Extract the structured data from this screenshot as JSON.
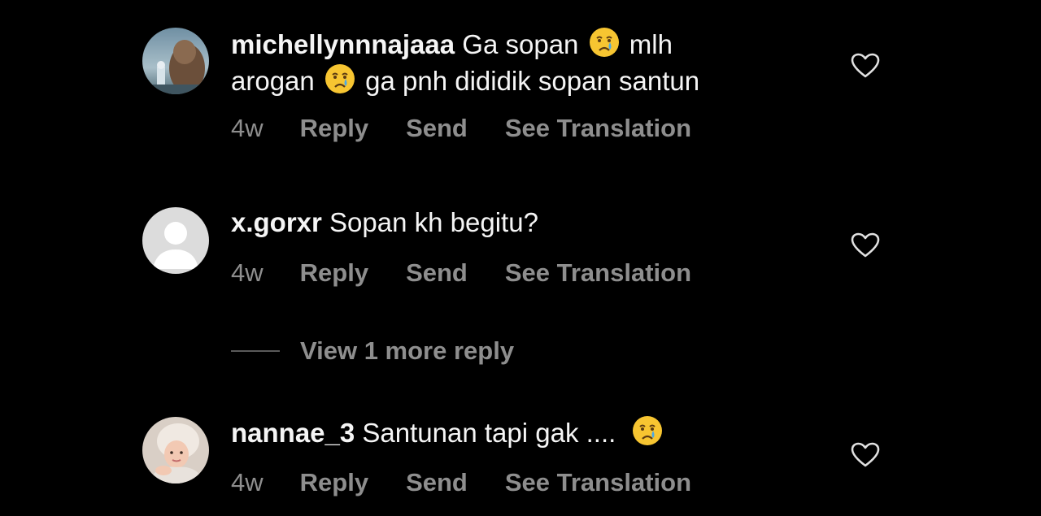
{
  "comments": [
    {
      "username": "michellynnnajaaa",
      "text_part1": "Ga sopan",
      "text_part2": "mlh",
      "text_part3": "arogan",
      "text_part4": "ga pnh dididik sopan santun",
      "time": "4w",
      "reply_label": "Reply",
      "send_label": "Send",
      "translate_label": "See Translation",
      "avatar_icon": "profile-photo",
      "emoji": "crying-face"
    },
    {
      "username": "x.gorxr",
      "text": "Sopan kh begitu?",
      "time": "4w",
      "reply_label": "Reply",
      "send_label": "Send",
      "translate_label": "See Translation",
      "avatar_icon": "default-avatar"
    },
    {
      "username": "nannae_3",
      "text": "Santunan tapi gak ....",
      "time": "4w",
      "reply_label": "Reply",
      "send_label": "Send",
      "translate_label": "See Translation",
      "avatar_icon": "profile-photo",
      "emoji": "crying-face"
    }
  ],
  "view_more_replies": "View 1 more reply",
  "colors": {
    "background": "#000000",
    "primary_text": "#f5f5f5",
    "secondary_text": "#8e8e8e"
  },
  "icons": {
    "like": "heart-outline-icon"
  }
}
